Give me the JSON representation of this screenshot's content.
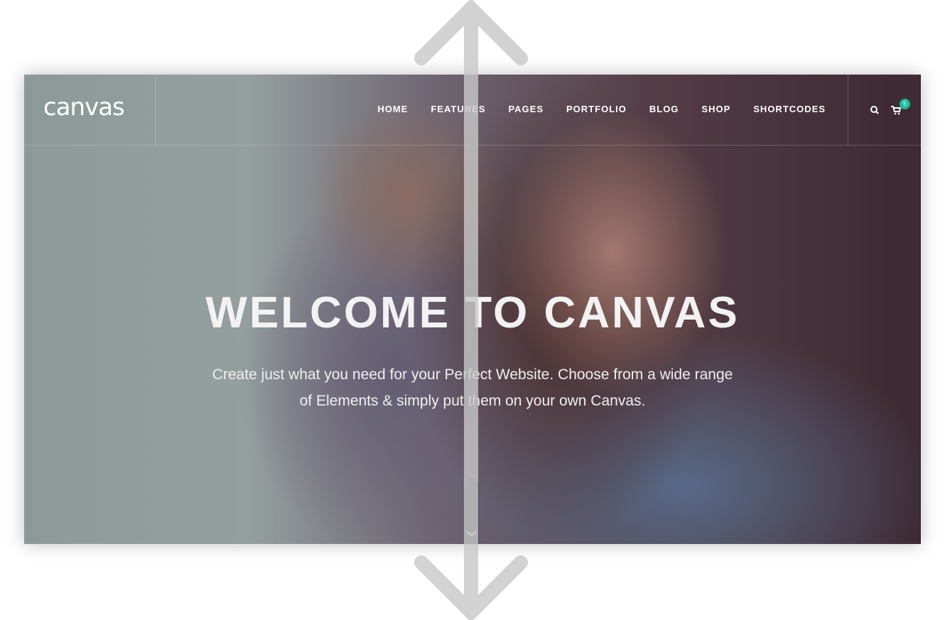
{
  "logo": "canvas",
  "menu": [
    "HOME",
    "FEATURES",
    "PAGES",
    "PORTFOLIO",
    "BLOG",
    "SHOP",
    "SHORTCODES"
  ],
  "cart_count": "5",
  "hero": {
    "title": "WELCOME TO CANVAS",
    "subtitle_1": "Create just what you need for your Perfect Website. Choose from a wide range",
    "subtitle_2": "of Elements & simply put them on your own Canvas."
  },
  "colors": {
    "badge": "#1abc9c"
  }
}
